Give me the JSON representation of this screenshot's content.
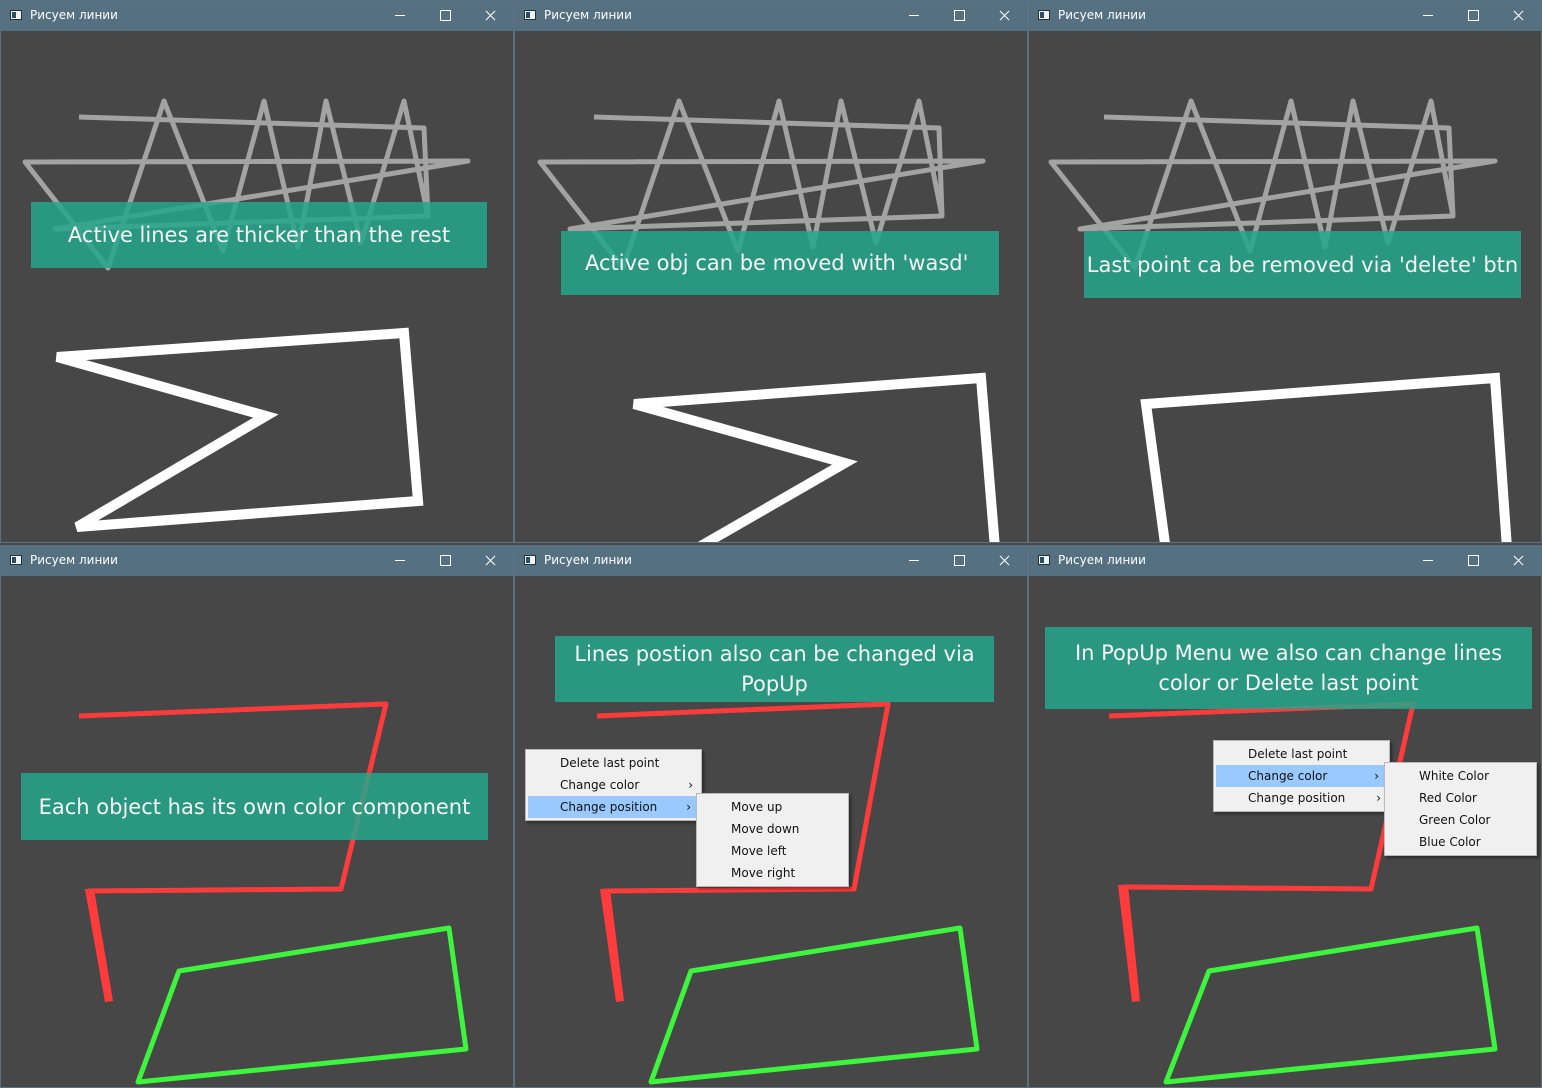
{
  "window_title": "Рисуем линии",
  "banners": {
    "w1": "Active lines are thicker than the rest",
    "w2": "Active obj can be moved with 'wasd'",
    "w3": "Last point ca be removed via 'delete' btn",
    "w4": "Each object has its own color component",
    "w5": "Lines postion also can be changed via PopUp",
    "w6": "In PopUp Menu we also can change lines color or Delete last point"
  },
  "popup_menu": {
    "items": [
      "Delete last point",
      "Change color",
      "Change position"
    ]
  },
  "position_submenu": {
    "items": [
      "Move up",
      "Move down",
      "Move left",
      "Move right"
    ]
  },
  "color_submenu": {
    "items": [
      "White Color",
      "Red Color",
      "Green Color",
      "Blue Color"
    ]
  },
  "colors": {
    "titlebar": "#557080",
    "canvas": "#474747",
    "gray_line": "#a3a3a3",
    "white_line": "#ffffff",
    "red_line": "#ff3b3b",
    "green_line": "#3ef53e",
    "banner": "#26a68b",
    "menu_highlight": "#99c9ff"
  }
}
